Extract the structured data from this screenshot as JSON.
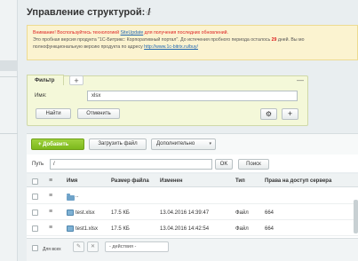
{
  "page": {
    "title": "Управление структурой: /",
    "star": "☆"
  },
  "notice": {
    "line1_warn": "Внимание! Воспользуйтесь технологией",
    "line1_link": "SiteUpdate",
    "line1_rest": "для получения последних обновлений.",
    "line2_a": "Это пробная версия продукта \"1С-Битрикс: Корпоративный портал\". До истечения пробного периода осталось",
    "line2_days": "29",
    "line2_b": "дней. Вы мо",
    "line3": "полнофункциональную версию продукта по адресу",
    "line3_link": "http://www.1c-bitrix.ru/buy/"
  },
  "filter": {
    "tab_label": "Фильтр",
    "add_tab": "+",
    "collapse": "—",
    "name_label": "Имя:",
    "name_value": "xlsx",
    "find_button": "Найти",
    "cancel_button": "Отменить",
    "gear": "⚙",
    "plus": "+"
  },
  "toolbar": {
    "add_button": "+ Добавить",
    "upload_button": "Загрузить файл",
    "more_button": "Дополнительно",
    "more_caret": "▾"
  },
  "path": {
    "label": "Путь",
    "value": "/",
    "ok_button": "OK",
    "search_button": "Поиск"
  },
  "table": {
    "columns": [
      "Имя",
      "Размер файла",
      "Изменен",
      "Тип",
      "Права на доступ сервера"
    ],
    "parent_row": "..",
    "rows": [
      {
        "name": "test.xlsx",
        "size": "17.5 КБ",
        "modified": "13.04.2016 14:39:47",
        "type": "Файл",
        "perm": "664"
      },
      {
        "name": "test1.xlsx",
        "size": "17.5 КБ",
        "modified": "13.04.2016 14:42:54",
        "type": "Файл",
        "perm": "664"
      }
    ]
  },
  "footer": {
    "for_all_label": "Для всех",
    "edit_icon": "✎",
    "delete_icon": "✕",
    "actions_select": "- действия -"
  }
}
